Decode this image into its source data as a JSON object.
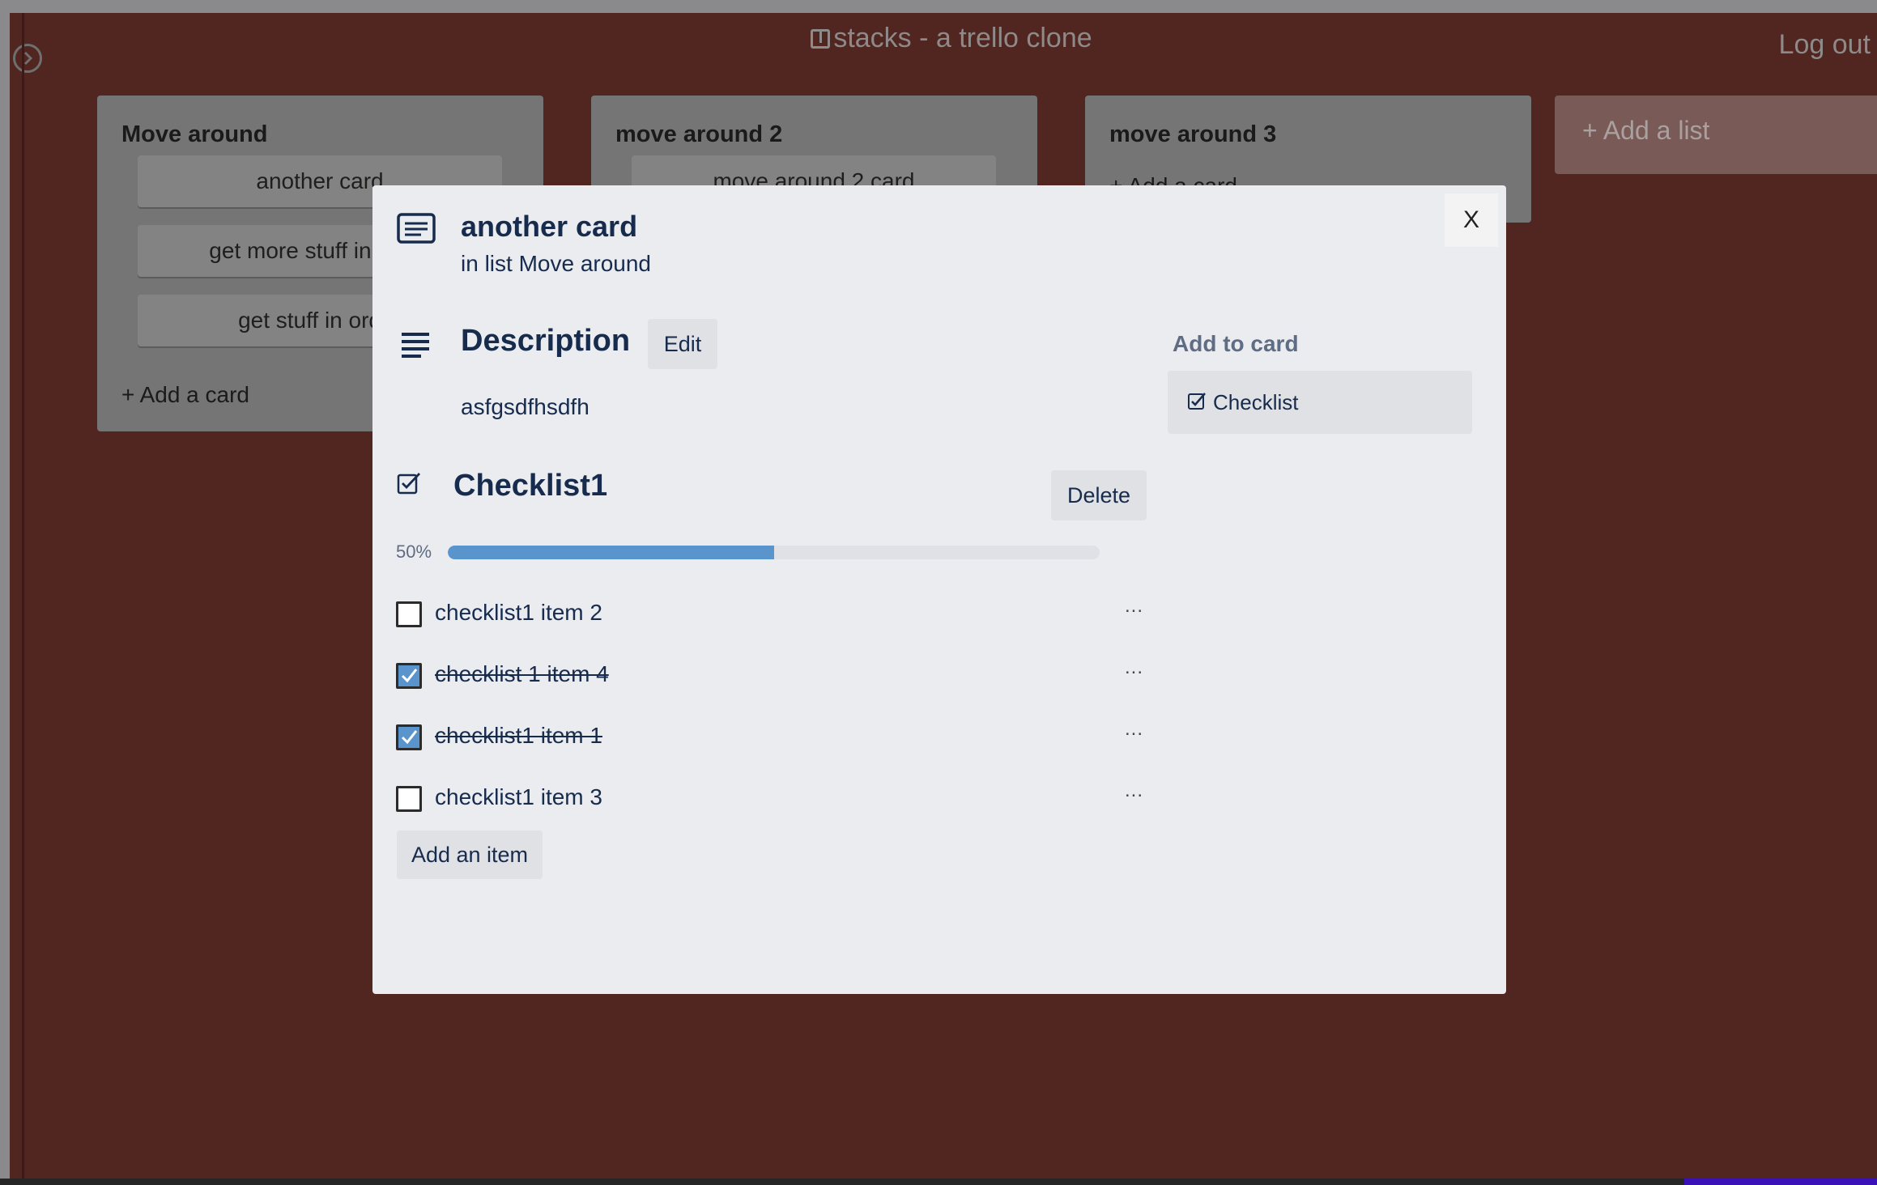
{
  "app": {
    "title": "stacks - a trello clone",
    "logout_label": "Log out"
  },
  "board": {
    "lists": [
      {
        "title": "Move around",
        "cards": [
          "another card",
          "get more stuff in order",
          "get stuff in order"
        ],
        "add_card_label": "+ Add a card"
      },
      {
        "title": "move around 2",
        "cards": [
          "move around 2 card"
        ],
        "add_card_label": "+ Add a card"
      },
      {
        "title": "move around 3",
        "cards": [],
        "add_card_label": "+ Add a card"
      }
    ],
    "add_list_label": "+ Add a list"
  },
  "modal": {
    "close_label": "X",
    "card_title": "another card",
    "card_subtitle": "in list Move around",
    "description": {
      "title": "Description",
      "edit_label": "Edit",
      "text": "asfgsdfhsdfh"
    },
    "sidebar": {
      "heading": "Add to card",
      "checklist_label": "Checklist"
    },
    "checklist": {
      "title": "Checklist1",
      "delete_label": "Delete",
      "progress_label": "50%",
      "progress": 0.5,
      "items": [
        {
          "text": "checklist1 item 2",
          "checked": false
        },
        {
          "text": "checklist 1 item 4",
          "checked": true
        },
        {
          "text": "checklist1 item 1",
          "checked": true
        },
        {
          "text": "checklist1 item 3",
          "checked": false
        }
      ],
      "more_label": "...",
      "add_item_label": "Add an item"
    }
  },
  "colors": {
    "background": "#512520",
    "modal": "#ebecf0",
    "progress": "#5a94cc",
    "text": "#172b4d"
  },
  "icons": {
    "sidebar_toggle": "chevron-right-circle-icon",
    "app_logo": "board-icon",
    "card": "card-icon",
    "description": "text-lines-icon",
    "checklist": "checkbox-icon"
  }
}
